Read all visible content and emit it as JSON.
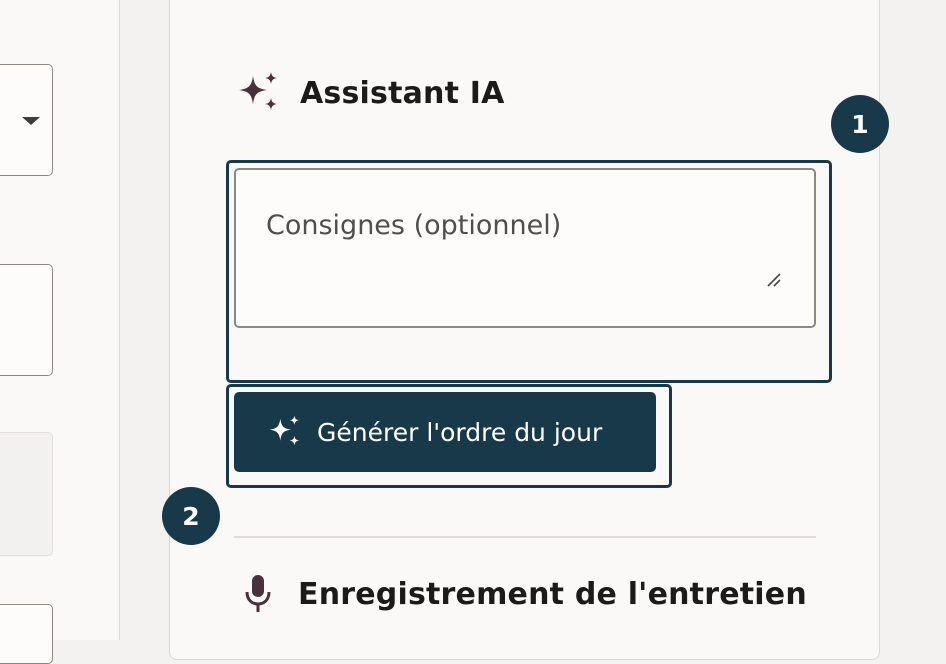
{
  "assistant": {
    "title": "Assistant IA",
    "instructions_placeholder": "Consignes (optionnel)",
    "generate_button_label": "Générer l'ordre du jour"
  },
  "recording": {
    "title": "Enregistrement de l'entretien"
  },
  "callouts": [
    "1",
    "2"
  ],
  "colors": {
    "accent": "#18394a",
    "sparkle_icon": "#4a2f3c",
    "panel_background": "#fbf9f7"
  },
  "icons": {
    "assistant": "sparkles-icon",
    "generate": "sparkles-icon",
    "recording": "microphone-icon",
    "select": "caret-down-icon"
  }
}
